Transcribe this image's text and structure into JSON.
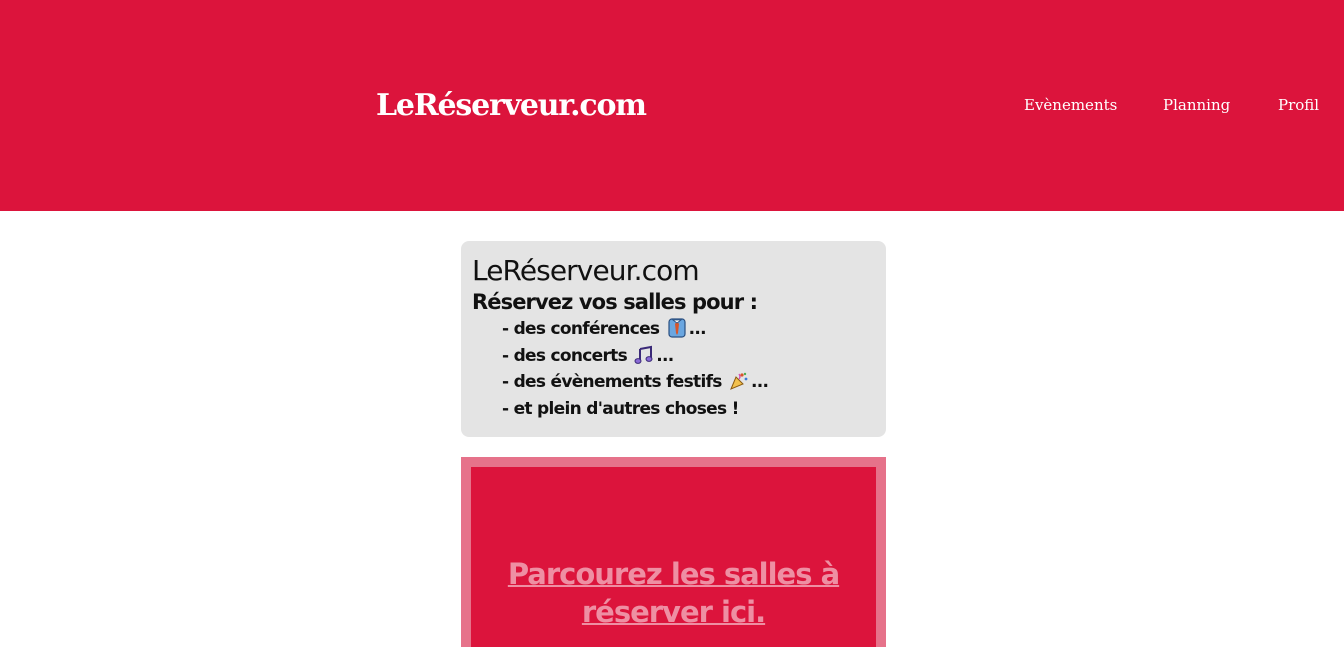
{
  "header": {
    "brand": "LeRéserveur.com",
    "background": "#dc143c",
    "nav": [
      {
        "label": "Evènements"
      },
      {
        "label": "Planning"
      },
      {
        "label": "Profil"
      }
    ]
  },
  "info_card": {
    "title": "LeRéserveur.com",
    "subtitle": "Réservez vos salles pour :",
    "items": [
      {
        "text": "- des conférences",
        "icon": "necktie-shirt-emoji",
        "suffix": "..."
      },
      {
        "text": "- des concerts",
        "icon": "musical-notes-emoji",
        "suffix": "..."
      },
      {
        "text": "- des évènements festifs",
        "icon": "party-popper-emoji",
        "suffix": "..."
      },
      {
        "text": "- et plein d'autres choses !"
      }
    ]
  },
  "cta": {
    "label": "Parcourez les salles à réserver ici.",
    "border_color": "#e6728a",
    "link_color": "#ee8fa3"
  }
}
